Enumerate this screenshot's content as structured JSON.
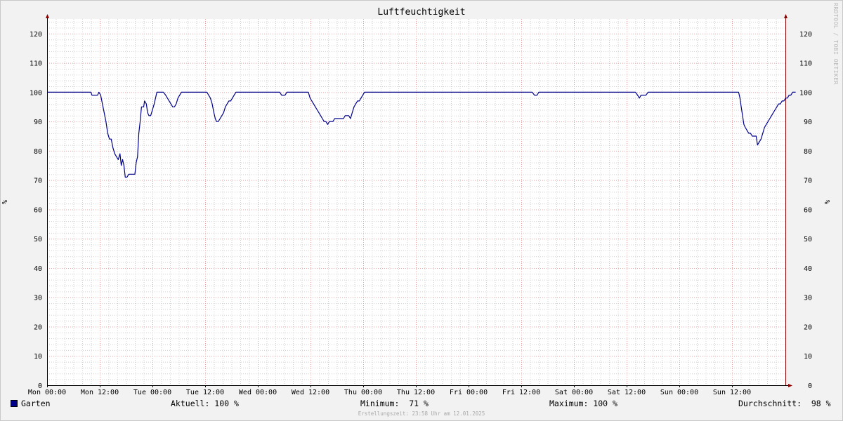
{
  "chart_data": {
    "type": "line",
    "title": "Luftfeuchtigkeit",
    "ylabel": "%",
    "ylim": [
      0,
      125
    ],
    "y_ticks": [
      0,
      10,
      20,
      30,
      40,
      50,
      60,
      70,
      80,
      90,
      100,
      110,
      120
    ],
    "x_ticks": [
      "Mon 00:00",
      "Mon 12:00",
      "Tue 00:00",
      "Tue 12:00",
      "Wed 00:00",
      "Wed 12:00",
      "Thu 00:00",
      "Thu 12:00",
      "Fri 00:00",
      "Fri 12:00",
      "Sat 00:00",
      "Sat 12:00",
      "Sun 00:00",
      "Sun 12:00"
    ],
    "x_unit": "hours since Mon 00:00",
    "xlim": [
      0,
      168
    ],
    "grid": true,
    "series": [
      {
        "name": "Garten",
        "color": "#00008b",
        "points": [
          [
            0,
            100
          ],
          [
            10,
            100
          ],
          [
            10.2,
            99
          ],
          [
            11.5,
            99
          ],
          [
            11.8,
            100
          ],
          [
            12.2,
            99
          ],
          [
            12.6,
            96
          ],
          [
            13,
            93
          ],
          [
            13.4,
            90
          ],
          [
            13.8,
            86
          ],
          [
            14.2,
            84
          ],
          [
            14.6,
            84
          ],
          [
            15,
            81
          ],
          [
            15.4,
            79
          ],
          [
            15.8,
            78
          ],
          [
            16.2,
            77
          ],
          [
            16.6,
            79
          ],
          [
            16.9,
            75
          ],
          [
            17.2,
            77
          ],
          [
            17.5,
            75
          ],
          [
            17.8,
            71
          ],
          [
            18.2,
            71
          ],
          [
            18.6,
            72
          ],
          [
            19.2,
            72
          ],
          [
            20,
            72
          ],
          [
            20.3,
            76
          ],
          [
            20.6,
            78
          ],
          [
            20.9,
            86
          ],
          [
            21.2,
            90
          ],
          [
            21.5,
            95
          ],
          [
            21.8,
            95
          ],
          [
            22,
            95
          ],
          [
            22.2,
            97
          ],
          [
            22.6,
            96
          ],
          [
            22.9,
            93
          ],
          [
            23.2,
            92
          ],
          [
            23.6,
            92
          ],
          [
            24,
            94
          ],
          [
            24.4,
            96
          ],
          [
            24.7,
            98
          ],
          [
            25,
            100
          ],
          [
            26.5,
            100
          ],
          [
            27,
            99
          ],
          [
            27.4,
            98
          ],
          [
            27.8,
            97
          ],
          [
            28.2,
            96
          ],
          [
            28.6,
            95
          ],
          [
            29,
            95
          ],
          [
            29.4,
            96
          ],
          [
            29.8,
            98
          ],
          [
            30.2,
            99
          ],
          [
            30.6,
            100
          ],
          [
            36,
            100
          ],
          [
            36.4,
            100
          ],
          [
            36.8,
            99
          ],
          [
            37.2,
            98
          ],
          [
            37.6,
            96
          ],
          [
            38,
            93
          ],
          [
            38.3,
            91
          ],
          [
            38.6,
            90
          ],
          [
            39,
            90
          ],
          [
            39.4,
            91
          ],
          [
            39.8,
            92
          ],
          [
            40.2,
            93
          ],
          [
            40.6,
            95
          ],
          [
            41,
            96
          ],
          [
            41.4,
            97
          ],
          [
            41.8,
            97
          ],
          [
            42.2,
            98
          ],
          [
            42.6,
            99
          ],
          [
            43,
            100
          ],
          [
            53,
            100
          ],
          [
            53.4,
            99
          ],
          [
            53.8,
            99
          ],
          [
            54.2,
            99
          ],
          [
            54.6,
            100
          ],
          [
            59.5,
            100
          ],
          [
            59.9,
            98
          ],
          [
            60.3,
            97
          ],
          [
            60.7,
            96
          ],
          [
            61.1,
            95
          ],
          [
            61.5,
            94
          ],
          [
            61.9,
            93
          ],
          [
            62.3,
            92
          ],
          [
            62.7,
            91
          ],
          [
            63.1,
            90
          ],
          [
            63.5,
            90
          ],
          [
            63.9,
            89
          ],
          [
            64.3,
            90
          ],
          [
            64.7,
            90
          ],
          [
            65.1,
            90
          ],
          [
            65.5,
            91
          ],
          [
            67.5,
            91
          ],
          [
            67.9,
            92
          ],
          [
            68.3,
            92
          ],
          [
            68.7,
            92
          ],
          [
            69.1,
            91
          ],
          [
            69.5,
            93
          ],
          [
            69.9,
            95
          ],
          [
            70.3,
            96
          ],
          [
            70.7,
            97
          ],
          [
            71.1,
            97
          ],
          [
            71.5,
            98
          ],
          [
            71.9,
            99
          ],
          [
            72.3,
            100
          ],
          [
            110.5,
            100
          ],
          [
            111,
            99
          ],
          [
            111.6,
            99
          ],
          [
            112,
            100
          ],
          [
            134,
            100
          ],
          [
            134.5,
            99
          ],
          [
            134.9,
            98
          ],
          [
            135.3,
            99
          ],
          [
            136,
            99
          ],
          [
            136.4,
            99
          ],
          [
            136.9,
            100
          ],
          [
            157.5,
            100
          ],
          [
            157.8,
            98
          ],
          [
            158.1,
            95
          ],
          [
            158.4,
            92
          ],
          [
            158.7,
            89
          ],
          [
            159,
            88
          ],
          [
            159.4,
            87
          ],
          [
            159.8,
            86
          ],
          [
            160.2,
            86
          ],
          [
            160.6,
            85
          ],
          [
            161,
            85
          ],
          [
            161.5,
            85
          ],
          [
            161.8,
            82
          ],
          [
            162.2,
            83
          ],
          [
            162.6,
            84
          ],
          [
            163,
            86
          ],
          [
            163.4,
            88
          ],
          [
            163.8,
            89
          ],
          [
            164.2,
            90
          ],
          [
            164.6,
            91
          ],
          [
            165,
            92
          ],
          [
            165.4,
            93
          ],
          [
            165.8,
            94
          ],
          [
            166.2,
            95
          ],
          [
            166.6,
            96
          ],
          [
            167,
            96
          ],
          [
            167.4,
            97
          ],
          [
            167.8,
            97
          ],
          [
            168.2,
            98
          ],
          [
            168.6,
            98
          ],
          [
            169,
            99
          ],
          [
            169.4,
            99
          ],
          [
            169.8,
            100
          ],
          [
            170.5,
            100
          ]
        ]
      }
    ]
  },
  "legend": {
    "series_name": "Garten",
    "current_label": "Aktuell: 100 %",
    "minimum_label": "Minimum:  71 %",
    "maximum_label": "Maximum: 100 %",
    "average_label": "Durchschnitt:  98 %"
  },
  "footer": {
    "creation_time": "Erstellungszeit: 23:58 Uhr am 12.01.2025"
  },
  "watermark": "RRDTOOL / TOBI OETIKER",
  "colors": {
    "background": "#f2f2f2",
    "plot_background": "#ffffff",
    "major_grid": "#e8a0a0",
    "minor_grid": "#d0d0d0",
    "axis": "#000000",
    "arrow": "#8b0000",
    "series": "#00008b"
  }
}
